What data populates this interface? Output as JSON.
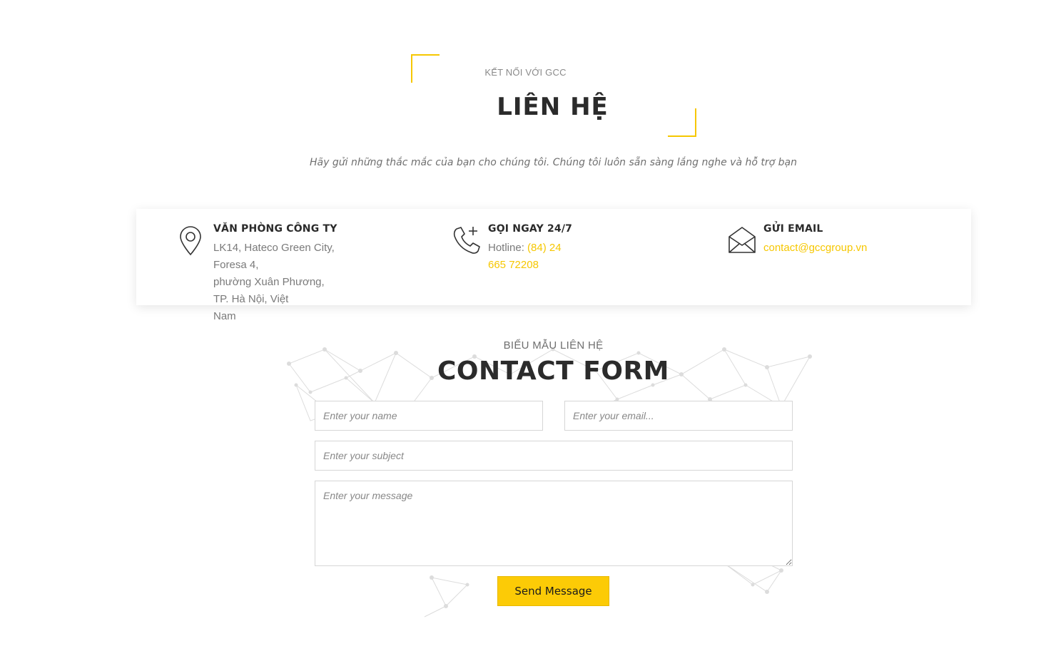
{
  "header": {
    "eyebrow": "KẾT NỐI VỚI GCC",
    "title": "LIÊN HỆ",
    "tagline": "Hãy gửi những thắc mắc của bạn cho chúng tôi. Chúng tôi luôn sẵn sàng lắng nghe và hỗ trợ bạn"
  },
  "info": {
    "office": {
      "icon": "map-pin-icon",
      "heading": "VĂN PHÒNG CÔNG TY",
      "address_line1": "LK14, Hateco Green City, Foresa 4,",
      "address_line2": "phường Xuân Phương, TP. Hà Nội, Việt",
      "address_line3": "Nam"
    },
    "phone": {
      "icon": "phone-plus-icon",
      "heading": "GỌI NGAY 24/7",
      "label": "Hotline: ",
      "number": "(84) 24 665 72208"
    },
    "email": {
      "icon": "envelope-open-icon",
      "heading": "GỬI EMAIL",
      "address": "contact@gccgroup.vn"
    }
  },
  "form": {
    "eyebrow": "BIỂU MẪU LIÊN HỆ",
    "title": "CONTACT FORM",
    "name_placeholder": "Enter your name",
    "email_placeholder": "Enter your email...",
    "subject_placeholder": "Enter your subject",
    "message_placeholder": "Enter your message",
    "send_label": "Send Message"
  },
  "colors": {
    "accent": "#f6c700",
    "button": "#fccb06",
    "heading": "#2b2b2b",
    "muted": "#7a7a7a"
  }
}
